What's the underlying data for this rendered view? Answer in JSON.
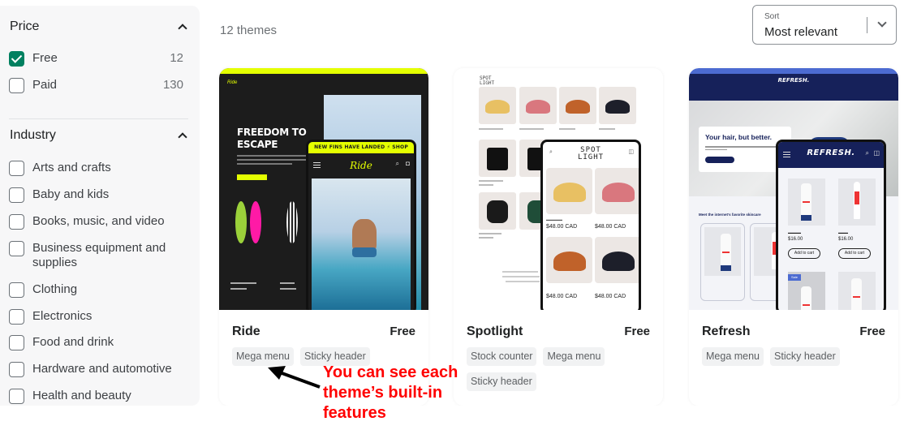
{
  "sidebar": {
    "price": {
      "title": "Price",
      "options": [
        {
          "label": "Free",
          "count": "12",
          "checked": true
        },
        {
          "label": "Paid",
          "count": "130",
          "checked": false
        }
      ]
    },
    "industry": {
      "title": "Industry",
      "options": [
        {
          "label": "Arts and crafts",
          "checked": false
        },
        {
          "label": "Baby and kids",
          "checked": false
        },
        {
          "label": "Books, music, and video",
          "checked": false
        },
        {
          "label": "Business equipment and supplies",
          "checked": false
        },
        {
          "label": "Clothing",
          "checked": false
        },
        {
          "label": "Electronics",
          "checked": false
        },
        {
          "label": "Food and drink",
          "checked": false
        },
        {
          "label": "Hardware and automotive",
          "checked": false
        },
        {
          "label": "Health and beauty",
          "checked": false
        }
      ]
    }
  },
  "header": {
    "count": "12 themes",
    "sort": {
      "label": "Sort",
      "value": "Most relevant"
    }
  },
  "themes": [
    {
      "name": "Ride",
      "price": "Free",
      "features": [
        "Mega menu",
        "Sticky header"
      ],
      "preview": {
        "headline_1": "FREEDOM TO",
        "headline_2": "ESCAPE",
        "mobile_banner": "NEW FINS HAVE LANDED ⚡ SHOP NOW →",
        "logo": "Ride",
        "accent": "#e4ff00"
      }
    },
    {
      "name": "Spotlight",
      "price": "Free",
      "features": [
        "Stock counter",
        "Mega menu",
        "Sticky header"
      ],
      "preview": {
        "logo_1": "SPOT",
        "logo_2": "LIGHT",
        "prices": [
          "$48.00 CAD",
          "$48.00 CAD",
          "$48.00 CAD",
          "$48.00 CAD"
        ]
      }
    },
    {
      "name": "Refresh",
      "price": "Free",
      "features": [
        "Mega menu",
        "Sticky header"
      ],
      "preview": {
        "logo": "REFRESH.",
        "hero_title": "Your hair, but better.",
        "section_title": "Meet the internet's favorite skincare",
        "prices": [
          "$16.00",
          "$16.00"
        ],
        "add_to_cart": "Add to cart",
        "sale_badge": "Sale",
        "accent": "#16215a"
      }
    }
  ],
  "annotation": {
    "text": "You can see each theme’s built-in features",
    "color": "#ff0000"
  },
  "colors": {
    "checkbox_checked": "#008060",
    "chip_bg": "#f1f2f3"
  }
}
